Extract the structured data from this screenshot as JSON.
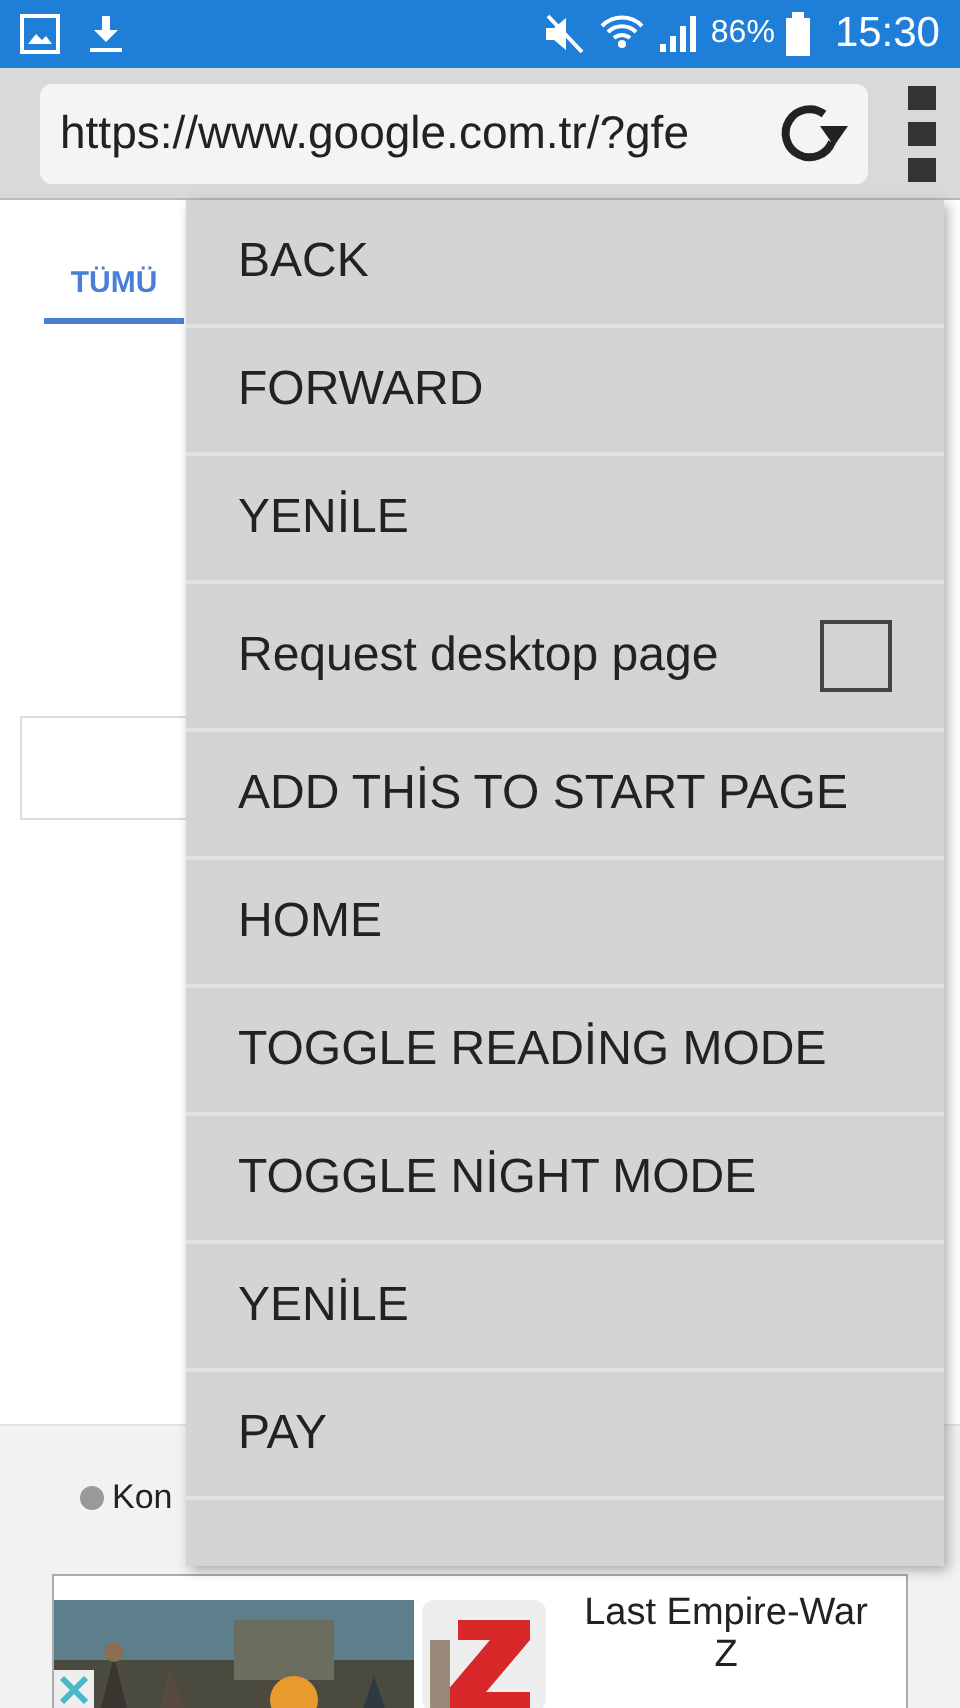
{
  "status_bar": {
    "battery_percent": "86%",
    "time": "15:30"
  },
  "address_bar": {
    "url": "https://www.google.com.tr/?gfe"
  },
  "page": {
    "tabs": [
      {
        "label": "TÜMÜ",
        "selected": true
      }
    ],
    "footer_text": "Kon"
  },
  "menu": {
    "items": [
      {
        "kind": "action",
        "label": "BACK"
      },
      {
        "kind": "action",
        "label": "FORWARD"
      },
      {
        "kind": "action",
        "label": "YENİLE"
      },
      {
        "kind": "checkbox",
        "label": "Request desktop page",
        "checked": false
      },
      {
        "kind": "action",
        "label": "ADD THİS TO START PAGE"
      },
      {
        "kind": "action",
        "label": "HOME"
      },
      {
        "kind": "action",
        "label": "TOGGLE READİNG MODE"
      },
      {
        "kind": "action",
        "label": "TOGGLE NİGHT MODE"
      },
      {
        "kind": "action",
        "label": "YENİLE"
      },
      {
        "kind": "action",
        "label": "PAY"
      },
      {
        "kind": "blank"
      }
    ]
  },
  "ad": {
    "title": "Last Empire-War Z"
  }
}
